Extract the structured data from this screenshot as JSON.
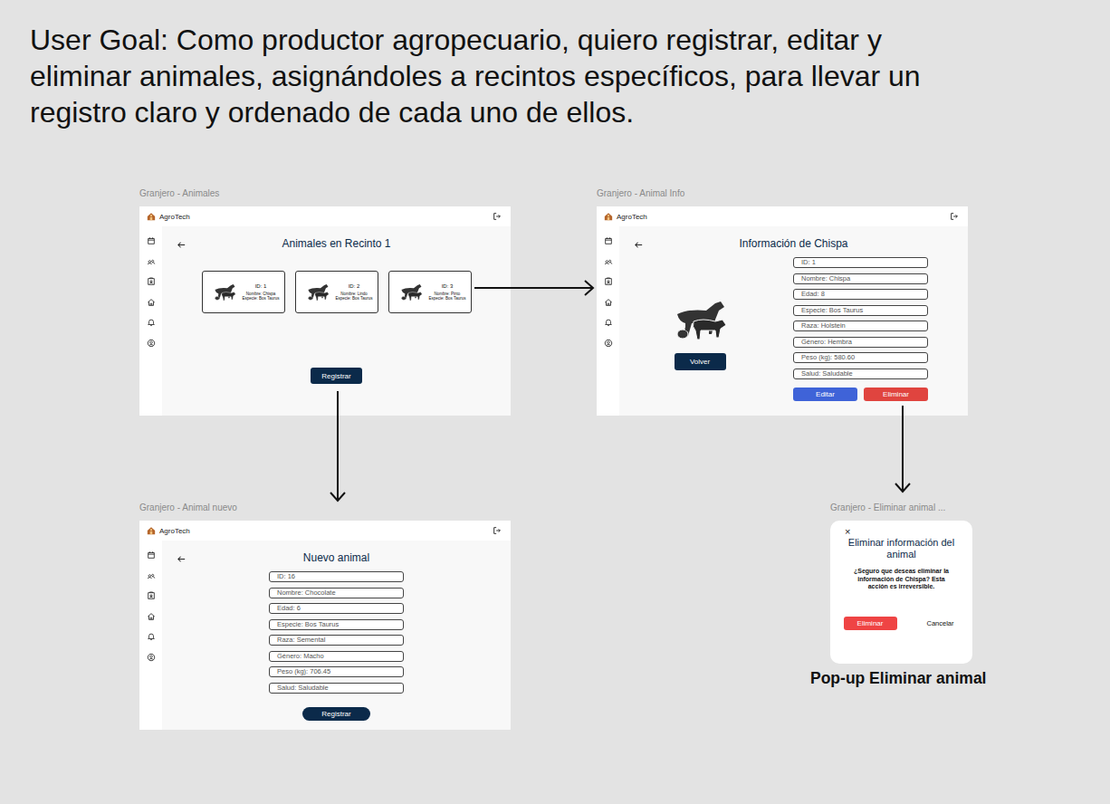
{
  "board": {
    "user_goal": [
      "User Goal: Como productor agropecuario, quiero registrar, editar y",
      "eliminar animales, asignándoles a recintos específicos, para llevar un",
      "registro claro y ordenado de cada uno de ellos."
    ]
  },
  "screens": [
    {
      "kind": "list",
      "label": "Granjero - Animales",
      "brand": "AgroTech",
      "title": "Animales en Recinto 1",
      "cards": [
        {
          "id": "ID: 1",
          "name": "Nombre: Chispa",
          "species": "Especie: Bos Taurus"
        },
        {
          "id": "ID: 2",
          "name": "Nombre: Lindo",
          "species": "Especie: Bos Taurus"
        },
        {
          "id": "ID: 3",
          "name": "Nombre: Pinto",
          "species": "Especie: Bos Taurus"
        }
      ],
      "button": "Registrar"
    },
    {
      "kind": "detail",
      "label": "Granjero - Animal Info",
      "brand": "AgroTech",
      "title": "Información de Chispa",
      "back_button": "Volver",
      "fields": [
        "ID: 1",
        "Nombre: Chispa",
        "Edad: 8",
        "Especie: Bos Taurus",
        "Raza: Holstein",
        "Género: Hembra",
        "Peso (kg): 580.60",
        "Salud: Saludable"
      ],
      "actions": [
        {
          "label": "Editar",
          "color": "#3f63d8"
        },
        {
          "label": "Eliminar",
          "color": "#e0443f"
        }
      ]
    },
    {
      "kind": "form",
      "label": "Granjero - Animal nuevo",
      "brand": "AgroTech",
      "title": "Nuevo animal",
      "fields": [
        "ID: 16",
        "Nombre: Chocolate",
        "Edad: 6",
        "Especie: Bos Taurus",
        "Raza: Semental",
        "Género: Macho",
        "Peso (kg): 706.45",
        "Salud: Saludable"
      ],
      "button": "Registrar"
    }
  ],
  "popup": {
    "label": "Granjero - Eliminar animal ...",
    "close": "×",
    "title": "Eliminar información del animal",
    "message": "¿Seguro que deseas eliminar la información de Chispa? Esta acción es irreversible.",
    "confirm": "Eliminar",
    "cancel": "Cancelar"
  },
  "caption": "Pop-up Eliminar animal"
}
